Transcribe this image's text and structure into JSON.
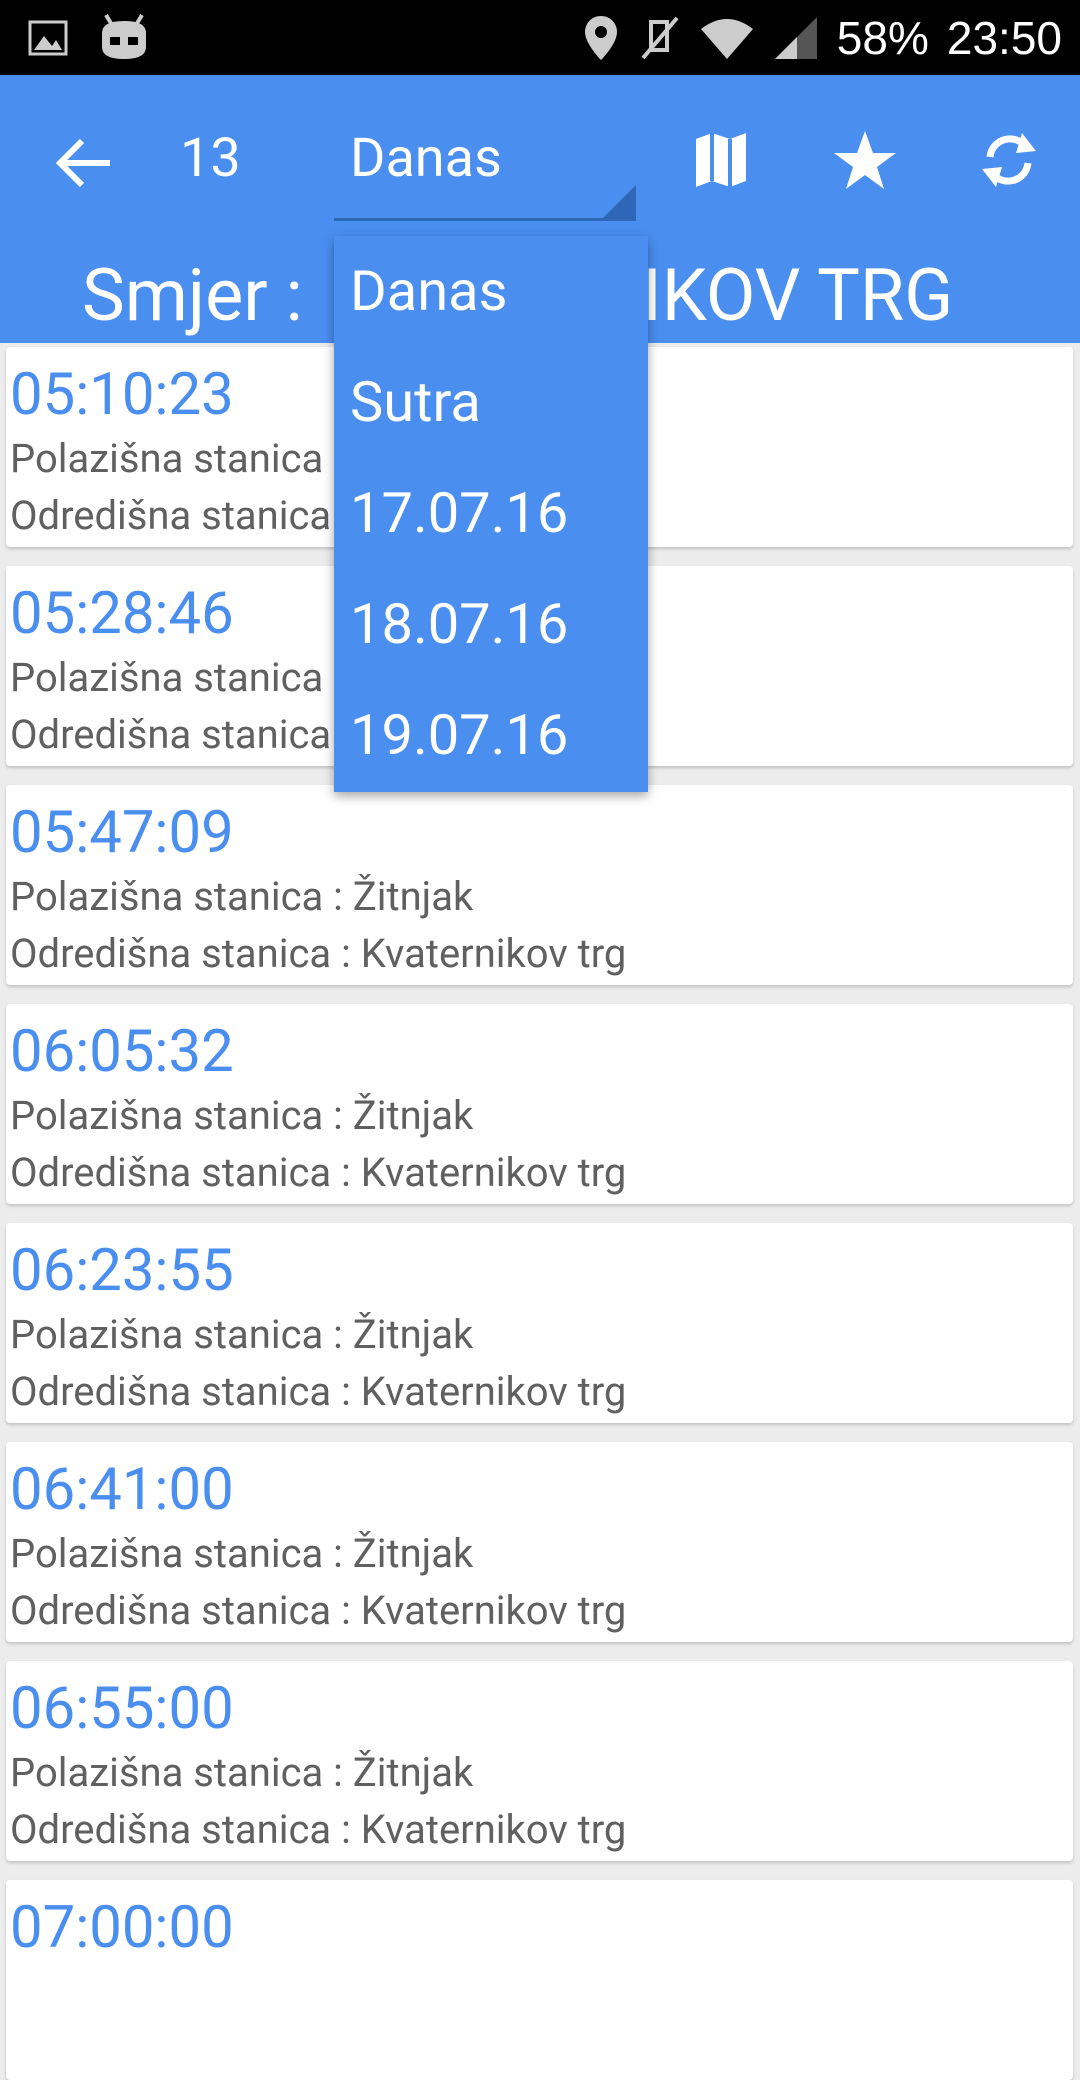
{
  "status_bar": {
    "battery": "58%",
    "time": "23:50",
    "icons": [
      "image-icon",
      "android-icon",
      "location-icon",
      "mute-icon",
      "wifi-icon",
      "signal-icon"
    ]
  },
  "app_bar": {
    "route": "13",
    "selected_day": "Danas",
    "direction": "Smjer : KVATERNIKOV TRG",
    "direction_visible": "Smjer : ",
    "direction_tail": "NIKOV TRG",
    "icons": [
      "back-arrow-icon",
      "map-icon",
      "star-icon",
      "refresh-icon"
    ]
  },
  "dropdown": {
    "options": [
      "Danas",
      "Sutra",
      "17.07.16",
      "18.07.16",
      "19.07.16"
    ]
  },
  "departures": [
    {
      "time": "05:10:23",
      "from": "Polazišna stanica : Žitnjak",
      "to": "Odredišna stanica : Kvaternikov trg"
    },
    {
      "time": "05:28:46",
      "from": "Polazišna stanica : Žitnjak",
      "to": "Odredišna stanica : Kvaternikov trg"
    },
    {
      "time": "05:47:09",
      "from": "Polazišna stanica : Žitnjak",
      "to": "Odredišna stanica : Kvaternikov trg"
    },
    {
      "time": "06:05:32",
      "from": "Polazišna stanica : Žitnjak",
      "to": "Odredišna stanica : Kvaternikov trg"
    },
    {
      "time": "06:23:55",
      "from": "Polazišna stanica : Žitnjak",
      "to": "Odredišna stanica : Kvaternikov trg"
    },
    {
      "time": "06:41:00",
      "from": "Polazišna stanica : Žitnjak",
      "to": "Odredišna stanica : Kvaternikov trg"
    },
    {
      "time": "06:55:00",
      "from": "Polazišna stanica : Žitnjak",
      "to": "Odredišna stanica : Kvaternikov trg"
    },
    {
      "time": "07:00:00",
      "from": "",
      "to": ""
    }
  ],
  "colors": {
    "primary": "#4a8ef0",
    "status_bar": "#000000",
    "card": "#ffffff",
    "secondary_text": "#606060"
  }
}
